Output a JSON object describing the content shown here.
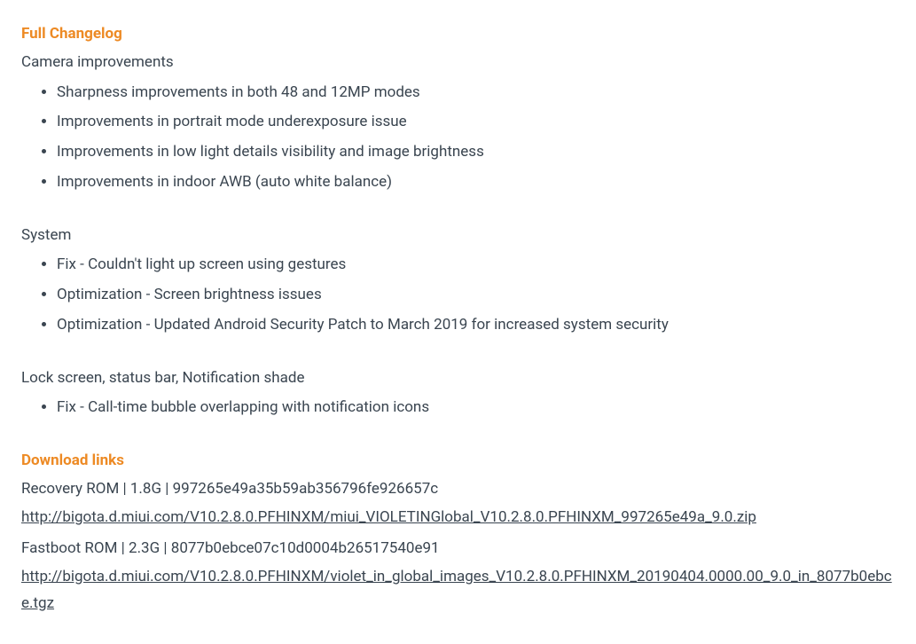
{
  "changelog": {
    "heading": "Full Changelog",
    "sections": [
      {
        "label": "Camera improvements",
        "items": [
          "Sharpness improvements in both 48 and 12MP modes",
          "Improvements in portrait mode underexposure issue",
          "Improvements in low light details visibility and image brightness",
          "Improvements in indoor AWB (auto white balance)"
        ]
      },
      {
        "label": "System",
        "items": [
          "Fix - Couldn't light up screen using gestures",
          "Optimization - Screen brightness issues",
          "Optimization - Updated Android Security Patch to March 2019 for increased system security"
        ]
      },
      {
        "label": "Lock screen, status bar, Notification shade",
        "items": [
          "Fix - Call-time bubble overlapping with notification icons"
        ]
      }
    ]
  },
  "downloads": {
    "heading": "Download links",
    "entries": [
      {
        "info": "Recovery ROM | 1.8G | 997265e49a35b59ab356796fe926657c",
        "url": "http://bigota.d.miui.com/V10.2.8.0.PFHINXM/miui_VIOLETINGlobal_V10.2.8.0.PFHINXM_997265e49a_9.0.zip"
      },
      {
        "info": "Fastboot ROM | 2.3G | 8077b0ebce07c10d0004b26517540e91",
        "url": "http://bigota.d.miui.com/V10.2.8.0.PFHINXM/violet_in_global_images_V10.2.8.0.PFHINXM_20190404.0000.00_9.0_in_8077b0ebce.tgz"
      }
    ]
  }
}
